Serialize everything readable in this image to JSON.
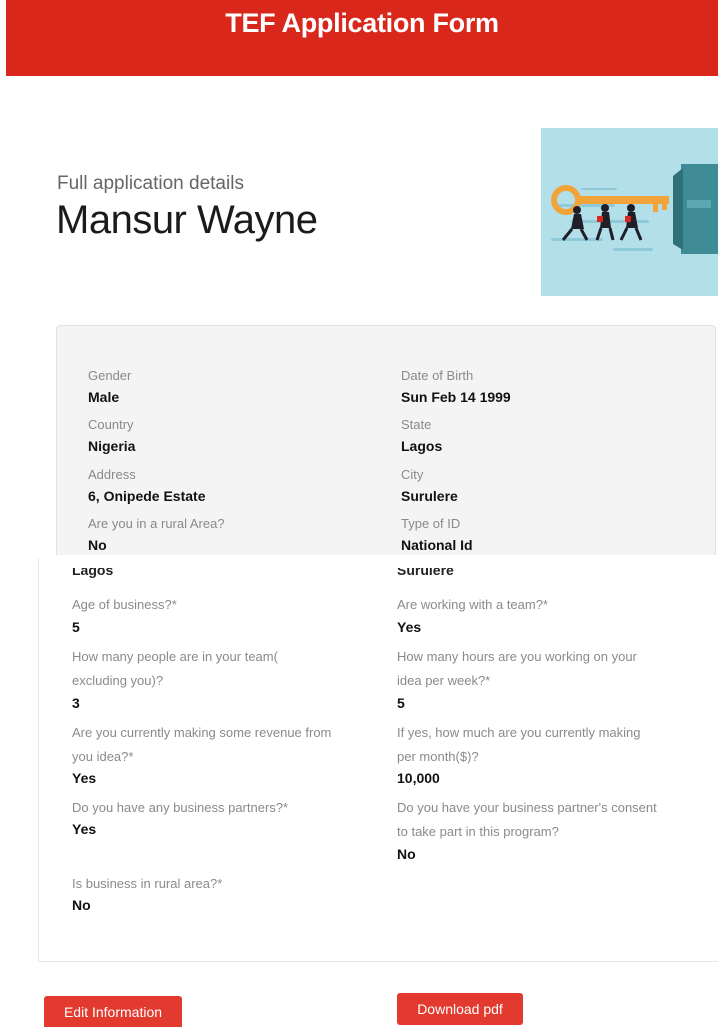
{
  "header": {
    "title": "TEF Application Form"
  },
  "profile": {
    "subtitle": "Full application details",
    "name": "Mansur Wayne"
  },
  "personal": {
    "gender_label": "Gender",
    "gender": "Male",
    "dob_label": "Date of Birth",
    "dob": "Sun Feb 14 1999",
    "country_label": "Country",
    "country": "Nigeria",
    "state_label": "State",
    "state": "Lagos",
    "address_label": "Address",
    "address": "6, Onipede Estate",
    "city_label": "City",
    "city": "Surulere",
    "rural_label": "Are you in a rural Area?",
    "rural": "No",
    "id_type_label": "Type of ID",
    "id_type": "National Id"
  },
  "business": {
    "clipped_left": "Lagos",
    "clipped_right": "Surulere",
    "age_label": "Age of business?*",
    "age": "5",
    "team_label": "Are working with a team?*",
    "team": "Yes",
    "team_size_label_1": "How many people are in your team(",
    "team_size_label_2": "excluding you)?",
    "team_size": "3",
    "hours_label_1": "How many hours are you working on your",
    "hours_label_2": "idea per week?*",
    "hours": "5",
    "revenue_label_1": "Are you currently making some revenue from",
    "revenue_label_2": "you idea?*",
    "revenue": "Yes",
    "revenue_amount_label_1": "If yes, how much are you currently making",
    "revenue_amount_label_2": "per month($)?",
    "revenue_amount": "10,000",
    "partners_label": "Do you have any business partners?*",
    "partners": "Yes",
    "consent_label_1": "Do you have your business partner's consent",
    "consent_label_2": "to take part in this program?",
    "consent": "No",
    "rural_business_label": "Is business in rural area?*",
    "rural_business": "No"
  },
  "actions": {
    "edit": "Edit Information",
    "download": "Download pdf"
  },
  "colors": {
    "brand_red": "#d9271c",
    "button_red": "#e23a2f",
    "illustration_bg": "#b3dfe9",
    "key_gold": "#f2a43a",
    "door_teal": "#3f8c96"
  }
}
